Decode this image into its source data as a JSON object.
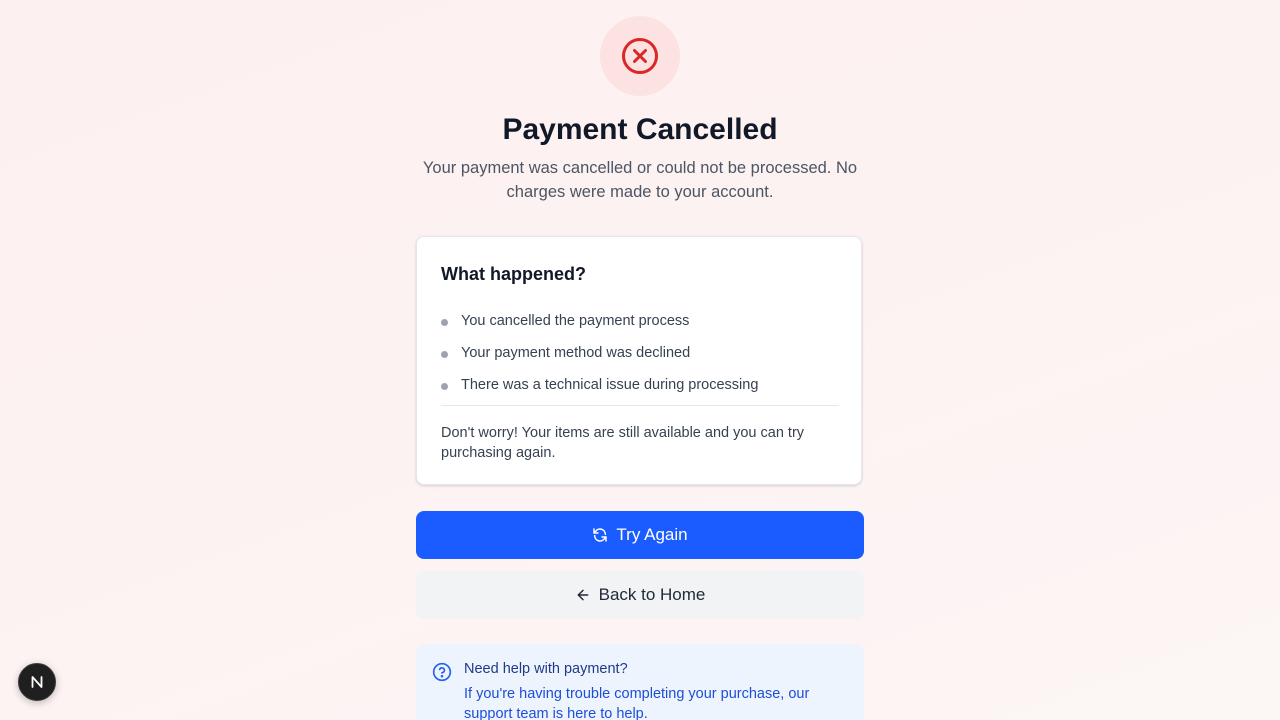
{
  "colors": {
    "danger": "#dc2626",
    "danger_bg": "#fde2e2",
    "primary": "#1a5cff",
    "secondary_bg": "#f2f3f5",
    "help_bg": "#eef4fd",
    "help_link": "#1d4ed8"
  },
  "status": {
    "icon": "x-circle-icon",
    "title": "Payment Cancelled",
    "subtitle": "Your payment was cancelled or could not be processed. No charges were made to your account."
  },
  "card": {
    "title": "What happened?",
    "reasons": [
      "You cancelled the payment process",
      "Your payment method was declined",
      "There was a technical issue during processing"
    ],
    "reassurance": "Don't worry! Your items are still available and you can try purchasing again."
  },
  "actions": {
    "try_again_label": "Try Again",
    "try_again_icon": "refresh-icon",
    "back_home_label": "Back to Home",
    "back_home_icon": "arrow-left-icon"
  },
  "help": {
    "icon": "help-circle-icon",
    "title": "Need help with payment?",
    "text": "If you're having trouble completing your purchase, our support team is here to help."
  },
  "dev_badge": {
    "icon": "nextjs-logo-icon",
    "letter": "N"
  }
}
